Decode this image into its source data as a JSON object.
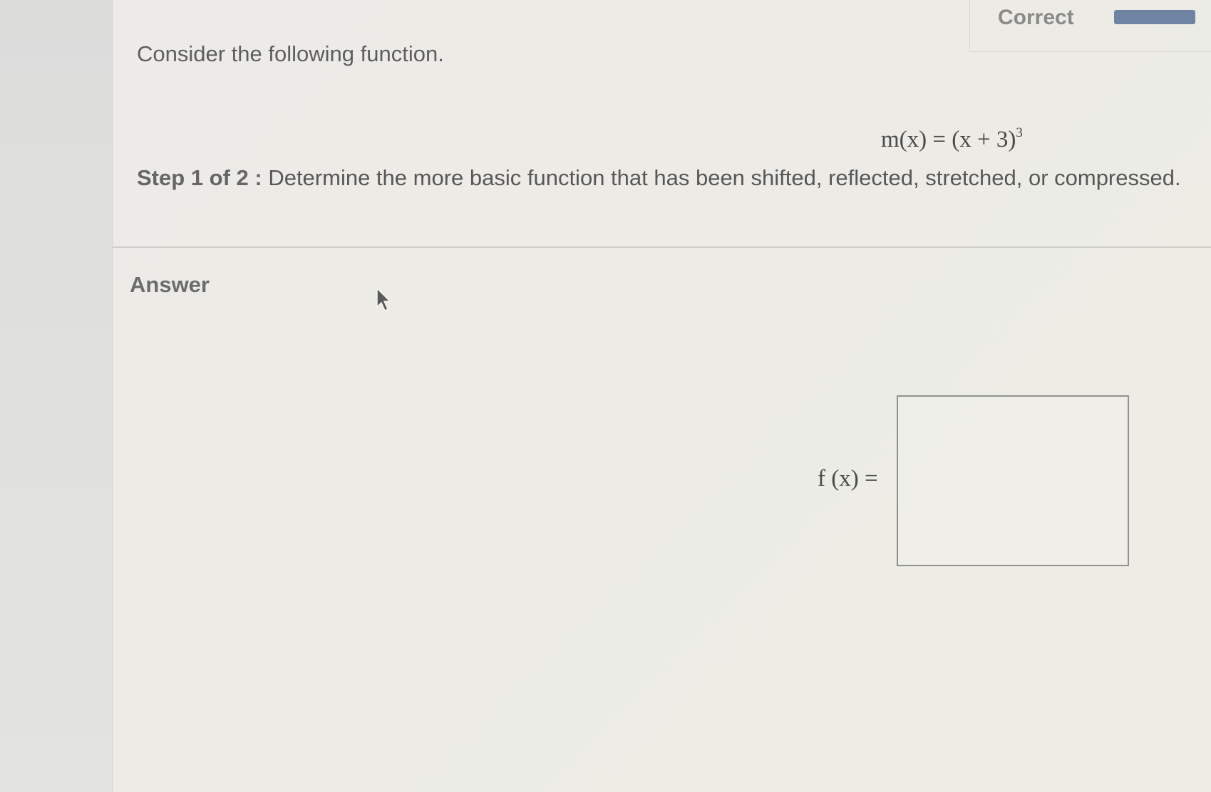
{
  "status": {
    "label": "Correct",
    "bar_color": "#6f84a3"
  },
  "question": {
    "intro": "Consider the following function.",
    "function_lhs": "m(x) = (x + 3)",
    "function_exponent": "3",
    "step_label": "Step 1 of 2 :",
    "step_text": " Determine the more basic function that has been shifted, reflected, stretched, or compressed."
  },
  "answer": {
    "heading": "Answer",
    "input_label": "f (x) =",
    "input_value": ""
  },
  "icons": {
    "cursor": "mouse-pointer-icon"
  }
}
